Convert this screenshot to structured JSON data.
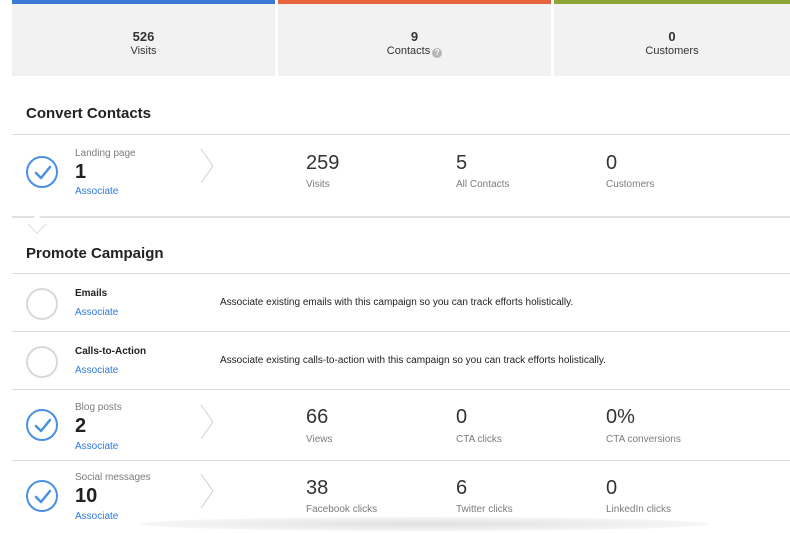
{
  "colors": {
    "visits_bar": "#3a7bd5",
    "contacts_bar": "#e8643c",
    "customers_bar": "#8fa436",
    "check_accent": "#4a90e2",
    "link": "#2b78e4"
  },
  "stats": {
    "visits": {
      "value": "526",
      "label": "Visits"
    },
    "contacts": {
      "value": "9",
      "label": "Contacts",
      "icon": "help-icon"
    },
    "customers": {
      "value": "0",
      "label": "Customers"
    }
  },
  "convert": {
    "title": "Convert Contacts",
    "landing": {
      "caption": "Landing page",
      "count": "1",
      "link": "Associate",
      "metrics": [
        {
          "value": "259",
          "label": "Visits"
        },
        {
          "value": "5",
          "label": "All Contacts"
        },
        {
          "value": "0",
          "label": "Customers"
        }
      ]
    }
  },
  "promote": {
    "title": "Promote Campaign",
    "emails": {
      "name": "Emails",
      "link": "Associate",
      "description": "Associate existing emails with this campaign so you can track efforts holistically."
    },
    "ctas": {
      "name": "Calls-to-Action",
      "link": "Associate",
      "description": "Associate existing calls-to-action with this campaign so you can track efforts holistically."
    },
    "blog": {
      "caption": "Blog posts",
      "count": "2",
      "link": "Associate",
      "metrics": [
        {
          "value": "66",
          "label": "Views"
        },
        {
          "value": "0",
          "label": "CTA clicks"
        },
        {
          "value": "0%",
          "label": "CTA conversions"
        }
      ]
    },
    "social": {
      "caption": "Social messages",
      "count": "10",
      "link": "Associate",
      "metrics": [
        {
          "value": "38",
          "label": "Facebook clicks"
        },
        {
          "value": "6",
          "label": "Twitter clicks"
        },
        {
          "value": "0",
          "label": "LinkedIn clicks"
        }
      ]
    }
  }
}
